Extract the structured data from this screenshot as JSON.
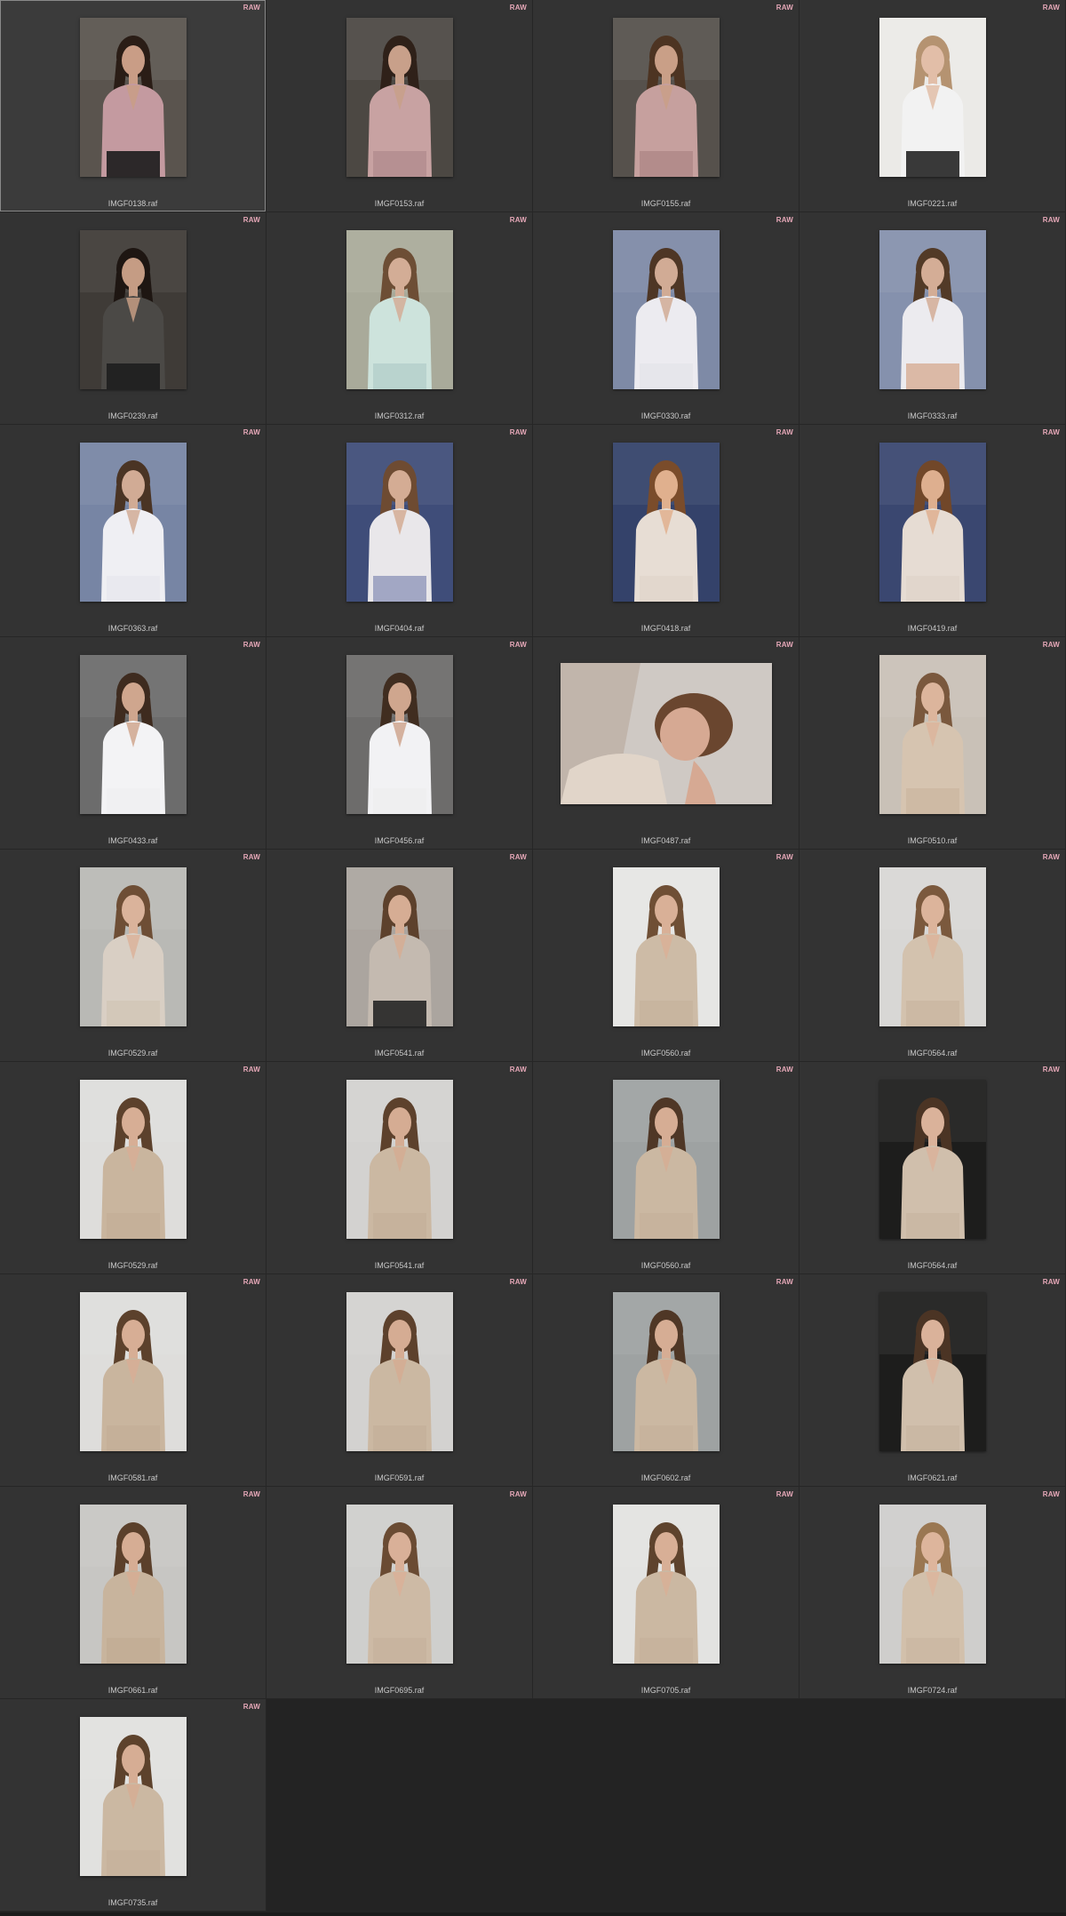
{
  "badge_label": "RAW",
  "selected_index": 0,
  "items": [
    {
      "file": "IMGF0138.raf",
      "orientation": "portrait",
      "bg": "#5a544e",
      "skin": "#c99d86",
      "hair": "#2a1d16",
      "top": "#c49aa0",
      "bottom": "#1c1c1c"
    },
    {
      "file": "IMGF0153.raf",
      "orientation": "portrait",
      "bg": "#4c4843",
      "skin": "#c8a08a",
      "hair": "#2f2119",
      "top": "#c8a2a2",
      "bottom": "#b48e90"
    },
    {
      "file": "IMGF0155.raf",
      "orientation": "portrait",
      "bg": "#56514c",
      "skin": "#c99f87",
      "hair": "#4d3422",
      "top": "#c6a09e",
      "bottom": "#b08a88"
    },
    {
      "file": "IMGF0221.raf",
      "orientation": "portrait",
      "bg": "#ebeae7",
      "skin": "#e2bea8",
      "hair": "#b59371",
      "top": "#f2f2f2",
      "bottom": "#252525"
    },
    {
      "file": "IMGF0239.raf",
      "orientation": "portrait",
      "bg": "#3f3b37",
      "skin": "#c59c84",
      "hair": "#1e1612",
      "top": "#4b4946",
      "bottom": "#1e1e1e"
    },
    {
      "file": "IMGF0312.raf",
      "orientation": "portrait",
      "bg": "#a9aa9a",
      "skin": "#d3ad96",
      "hair": "#6d4e35",
      "top": "#cde3dc",
      "bottom": "#b7d0cc"
    },
    {
      "file": "IMGF0330.raf",
      "orientation": "portrait",
      "bg": "#7e8aa6",
      "skin": "#d1ab95",
      "hair": "#4e3625",
      "top": "#ecebf0",
      "bottom": "#e5e5ea"
    },
    {
      "file": "IMGF0333.raf",
      "orientation": "portrait",
      "bg": "#8591ad",
      "skin": "#d4ad96",
      "hair": "#523a27",
      "top": "#ecebef",
      "bottom": "#d9b49d"
    },
    {
      "file": "IMGF0363.raf",
      "orientation": "portrait",
      "bg": "#7785a4",
      "skin": "#d1ab95",
      "hair": "#4a3424",
      "top": "#efeff3",
      "bottom": "#e8e8ee"
    },
    {
      "file": "IMGF0404.raf",
      "orientation": "portrait",
      "bg": "#3f4d79",
      "skin": "#d4ac94",
      "hair": "#6e4b32",
      "top": "#e9e7ea",
      "bottom": "#9aa0c0"
    },
    {
      "file": "IMGF0418.raf",
      "orientation": "portrait",
      "bg": "#34426a",
      "skin": "#e0b08e",
      "hair": "#7a4c2b",
      "top": "#e7ddd4",
      "bottom": "#e1d6cc"
    },
    {
      "file": "IMGF0419.raf",
      "orientation": "portrait",
      "bg": "#3a4770",
      "skin": "#deaf8f",
      "hair": "#714729",
      "top": "#e6dcd3",
      "bottom": "#e0d5cb"
    },
    {
      "file": "IMGF0433.raf",
      "orientation": "portrait",
      "bg": "#6c6c6c",
      "skin": "#cfa68e",
      "hair": "#3e2b1f",
      "top": "#f3f3f5",
      "bottom": "#f0f0f2"
    },
    {
      "file": "IMGF0456.raf",
      "orientation": "portrait",
      "bg": "#6d6c6b",
      "skin": "#cfa68e",
      "hair": "#402d20",
      "top": "#f2f2f4",
      "bottom": "#eeeef0"
    },
    {
      "file": "IMGF0487.raf",
      "orientation": "landscape",
      "bg": "#cfc9c4",
      "skin": "#d6a993",
      "hair": "#6a462f",
      "top": "#e1d5c9",
      "bottom": "#b7a497"
    },
    {
      "file": "IMGF0510.raf",
      "orientation": "portrait",
      "bg": "#c9c1b7",
      "skin": "#dcb59c",
      "hair": "#7a583d",
      "top": "#d6c4b0",
      "bottom": "#cdb9a3"
    },
    {
      "file": "IMGF0529.raf",
      "orientation": "portrait",
      "bg": "#b9b9b5",
      "skin": "#dab39b",
      "hair": "#6e4e35",
      "top": "#d9cfc4",
      "bottom": "#d2c6b8"
    },
    {
      "file": "IMGF0541.raf",
      "orientation": "portrait",
      "bg": "#aba59f",
      "skin": "#d6ad94",
      "hair": "#5d412c",
      "top": "#c4bab0",
      "bottom": "#262626"
    },
    {
      "file": "IMGF0560.raf",
      "orientation": "portrait",
      "bg": "#e6e6e4",
      "skin": "#d9b097",
      "hair": "#6f4f35",
      "top": "#cdbba6",
      "bottom": "#c8b59f"
    },
    {
      "file": "IMGF0564.raf",
      "orientation": "portrait",
      "bg": "#d8d7d5",
      "skin": "#dcb49b",
      "hair": "#7b593d",
      "top": "#d3c2ae",
      "bottom": "#cbb8a3"
    },
    {
      "file": "IMGF0529.raf",
      "orientation": "portrait",
      "bg": "#dedddb",
      "skin": "#d7ae95",
      "hair": "#5c412c",
      "top": "#c9b59e",
      "bottom": "#c4af98"
    },
    {
      "file": "IMGF0541.raf",
      "orientation": "portrait",
      "bg": "#d3d2d0",
      "skin": "#d5ac93",
      "hair": "#5d412c",
      "top": "#cbb8a2",
      "bottom": "#c5b19b"
    },
    {
      "file": "IMGF0560.raf",
      "orientation": "portrait",
      "bg": "#9ea2a2",
      "skin": "#d6ad94",
      "hair": "#4f3726",
      "top": "#cbb8a2",
      "bottom": "#c6b29c"
    },
    {
      "file": "IMGF0564.raf",
      "orientation": "portrait",
      "bg": "#1d1d1c",
      "skin": "#dab29a",
      "hair": "#4b3424",
      "top": "#d0bfac",
      "bottom": "#c9b7a3"
    },
    {
      "file": "IMGF0581.raf",
      "orientation": "portrait",
      "bg": "#dedddb",
      "skin": "#d7ae95",
      "hair": "#5c412c",
      "top": "#c9b59e",
      "bottom": "#c4af98"
    },
    {
      "file": "IMGF0591.raf",
      "orientation": "portrait",
      "bg": "#d3d2d0",
      "skin": "#d5ac93",
      "hair": "#5d412c",
      "top": "#cbb8a2",
      "bottom": "#c5b19b"
    },
    {
      "file": "IMGF0602.raf",
      "orientation": "portrait",
      "bg": "#9ea2a2",
      "skin": "#d6ad94",
      "hair": "#4f3726",
      "top": "#cbb8a2",
      "bottom": "#c6b29c"
    },
    {
      "file": "IMGF0621.raf",
      "orientation": "portrait",
      "bg": "#1d1d1c",
      "skin": "#dab29a",
      "hair": "#4b3424",
      "top": "#d0bfac",
      "bottom": "#c9b7a3"
    },
    {
      "file": "IMGF0661.raf",
      "orientation": "portrait",
      "bg": "#c7c6c3",
      "skin": "#d6ad94",
      "hair": "#5b402b",
      "top": "#c8b49d",
      "bottom": "#c2ad96"
    },
    {
      "file": "IMGF0695.raf",
      "orientation": "portrait",
      "bg": "#cfcfcd",
      "skin": "#d9b098",
      "hair": "#6a4b33",
      "top": "#cdbaa5",
      "bottom": "#c8b49f"
    },
    {
      "file": "IMGF0705.raf",
      "orientation": "portrait",
      "bg": "#e3e3e1",
      "skin": "#d8af96",
      "hair": "#5e432d",
      "top": "#cbb8a2",
      "bottom": "#c6b29c"
    },
    {
      "file": "IMGF0724.raf",
      "orientation": "portrait",
      "bg": "#cfcecc",
      "skin": "#ddb59c",
      "hair": "#9a7752",
      "top": "#d2c0ab",
      "bottom": "#cbb8a3"
    },
    {
      "file": "IMGF0735.raf",
      "orientation": "portrait",
      "bg": "#e1e1df",
      "skin": "#d6ad94",
      "hair": "#5d422c",
      "top": "#cbb8a2",
      "bottom": "#c6b29c"
    }
  ]
}
